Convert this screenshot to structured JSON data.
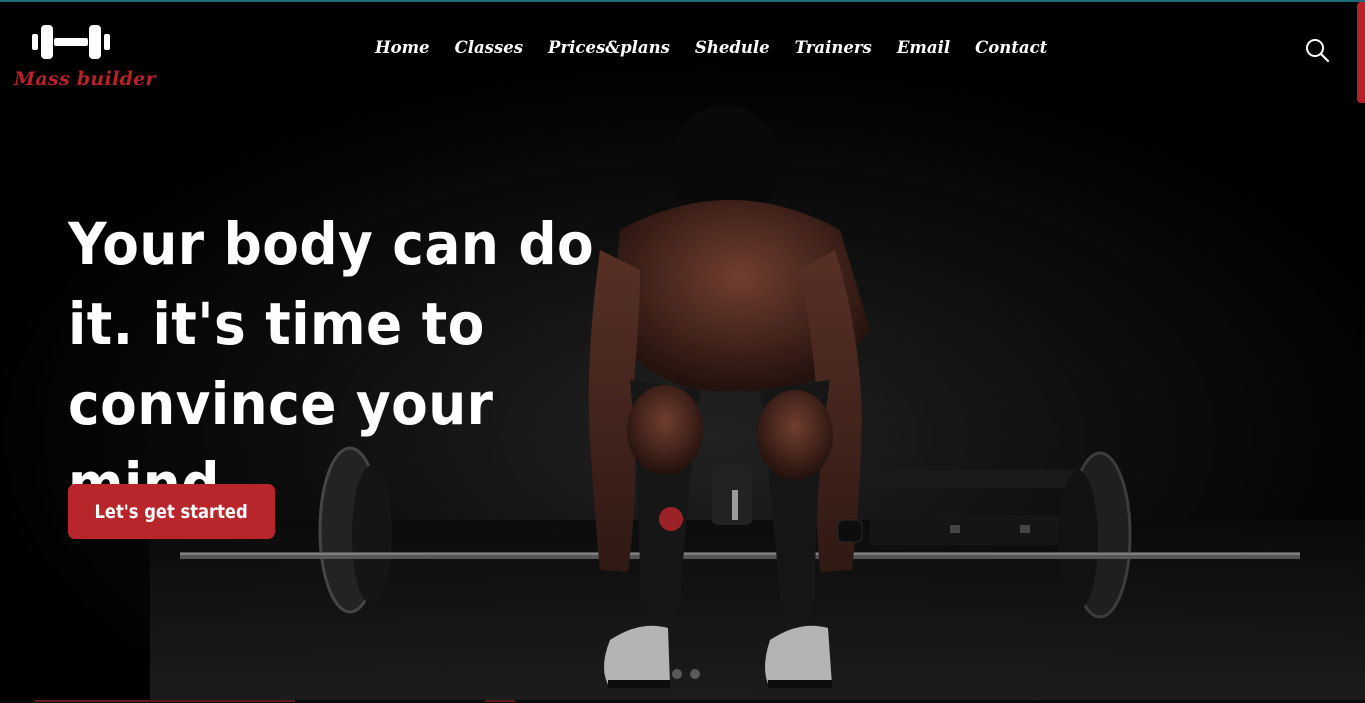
{
  "brand": {
    "name": "Mass builder",
    "logo_icon": "dumbbell-icon",
    "accent_color": "#b8202a"
  },
  "nav": {
    "items": [
      {
        "label": "Home"
      },
      {
        "label": "Classes"
      },
      {
        "label": "Prices&plans"
      },
      {
        "label": "Shedule"
      },
      {
        "label": "Trainers"
      },
      {
        "label": "Email"
      },
      {
        "label": "Contact"
      }
    ],
    "search_icon": "search-icon"
  },
  "hero": {
    "headline": "Your body can do it. it's time to convince your mind.",
    "cta_label": "Let's get started",
    "cta_color": "#b8262b",
    "background_image": "man-lifting-barbell-photo"
  }
}
